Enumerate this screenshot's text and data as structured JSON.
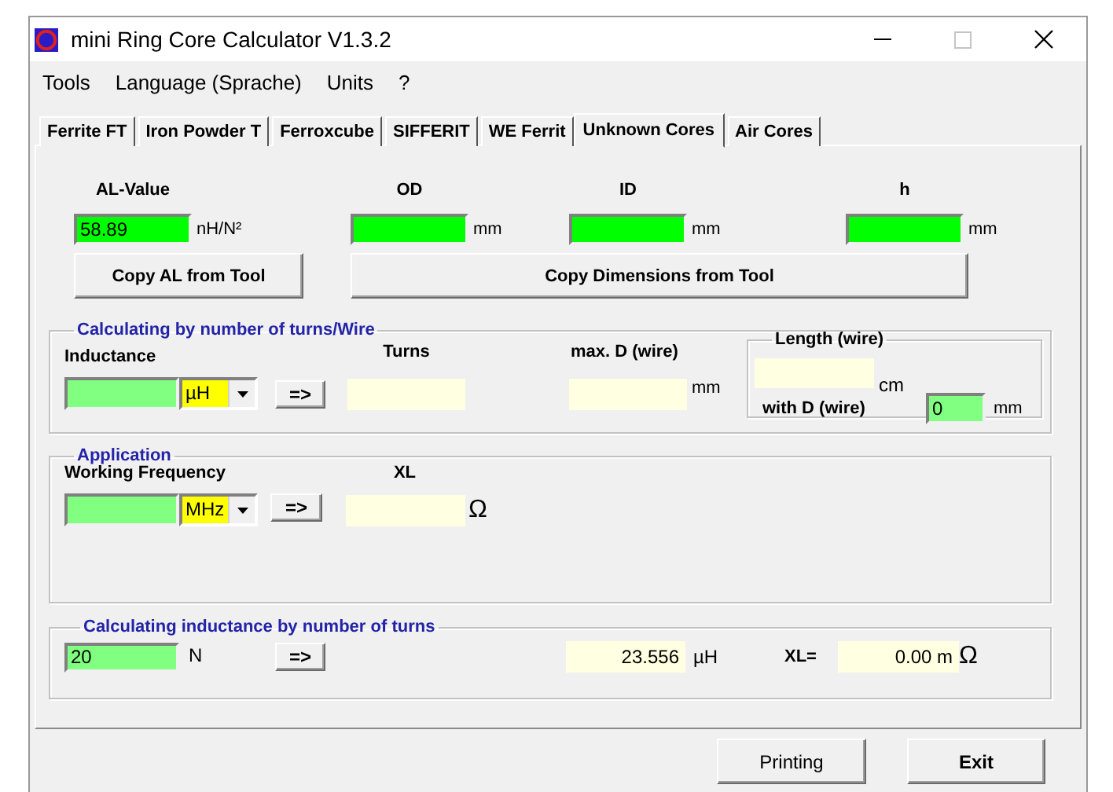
{
  "window": {
    "title": "mini Ring Core Calculator V1.3.2"
  },
  "menu": [
    "Tools",
    "Language (Sprache)",
    "Units",
    "?"
  ],
  "tabs": [
    {
      "label": "Ferrite FT",
      "selected": false
    },
    {
      "label": "Iron Powder T",
      "selected": false
    },
    {
      "label": "Ferroxcube",
      "selected": false
    },
    {
      "label": "SIFFERIT",
      "selected": false
    },
    {
      "label": "WE Ferrit",
      "selected": false
    },
    {
      "label": "Unknown Cores",
      "selected": true
    },
    {
      "label": "Air Cores",
      "selected": false
    }
  ],
  "core": {
    "fields": [
      {
        "label": "AL-Value",
        "value": "58.89",
        "unit": "nH/N²"
      },
      {
        "label": "OD",
        "unit": "mm"
      },
      {
        "label": "ID",
        "unit": "mm"
      },
      {
        "label": "h",
        "unit": "mm"
      }
    ],
    "buttons": [
      "Copy AL from Tool",
      "Copy Dimensions from Tool"
    ]
  },
  "turns_wire": {
    "title": "Calculating by number of turns/Wire",
    "inductance_label": "Inductance",
    "inductance_unit": "µH",
    "calc_button": "=>",
    "turns_label": "Turns",
    "max_d_label": "max. D (wire)",
    "max_d_unit": "mm",
    "length": {
      "title": "Length (wire)",
      "unit": "cm",
      "d_label": "with D (wire)",
      "d_value": "0",
      "d_unit": "mm"
    }
  },
  "application": {
    "title": "Application",
    "frequency_label": "Working Frequency",
    "frequency_unit": "MHz",
    "calc_button": "=>",
    "xl_label": "XL",
    "xl_unit": "Ω"
  },
  "inductance_by_turns": {
    "title": "Calculating inductance by number of turns",
    "turns_value": "20",
    "turns_unit": "N",
    "calc_button": "=>",
    "inductance_value": "23.556",
    "inductance_unit": "µH",
    "xl_label": "XL=",
    "xl_value": "0.00 m",
    "xl_unit": "Ω"
  },
  "buttons": [
    "Printing",
    "Exit"
  ]
}
